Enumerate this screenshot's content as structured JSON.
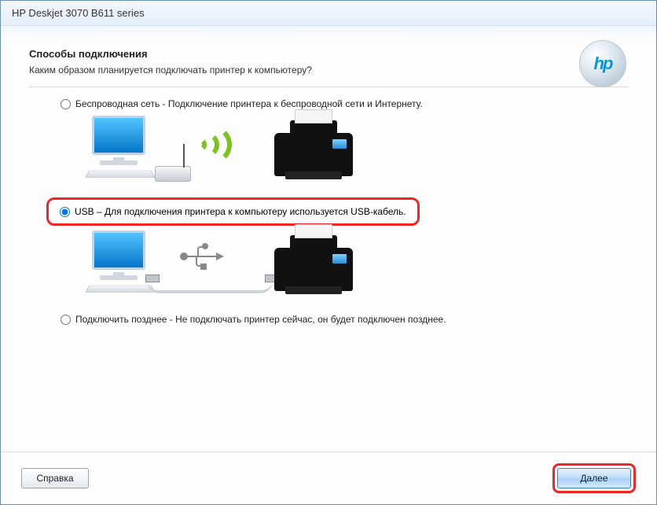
{
  "window": {
    "title": "HP Deskjet 3070 B611 series"
  },
  "header": {
    "heading": "Способы подключения",
    "subheading": "Каким образом планируется подключать принтер к компьютеру?",
    "logo_text": "hp"
  },
  "options": {
    "wireless": {
      "label": "Беспроводная сеть - Подключение принтера к беспроводной сети и Интернету."
    },
    "usb": {
      "label": "USB – Для подключения принтера к компьютеру используется USB-кабель."
    },
    "later": {
      "label": "Подключить позднее - Не подключать принтер сейчас, он будет подключен  позднее."
    },
    "selected": "usb"
  },
  "footer": {
    "help_label": "Справка",
    "next_label": "Далее"
  }
}
